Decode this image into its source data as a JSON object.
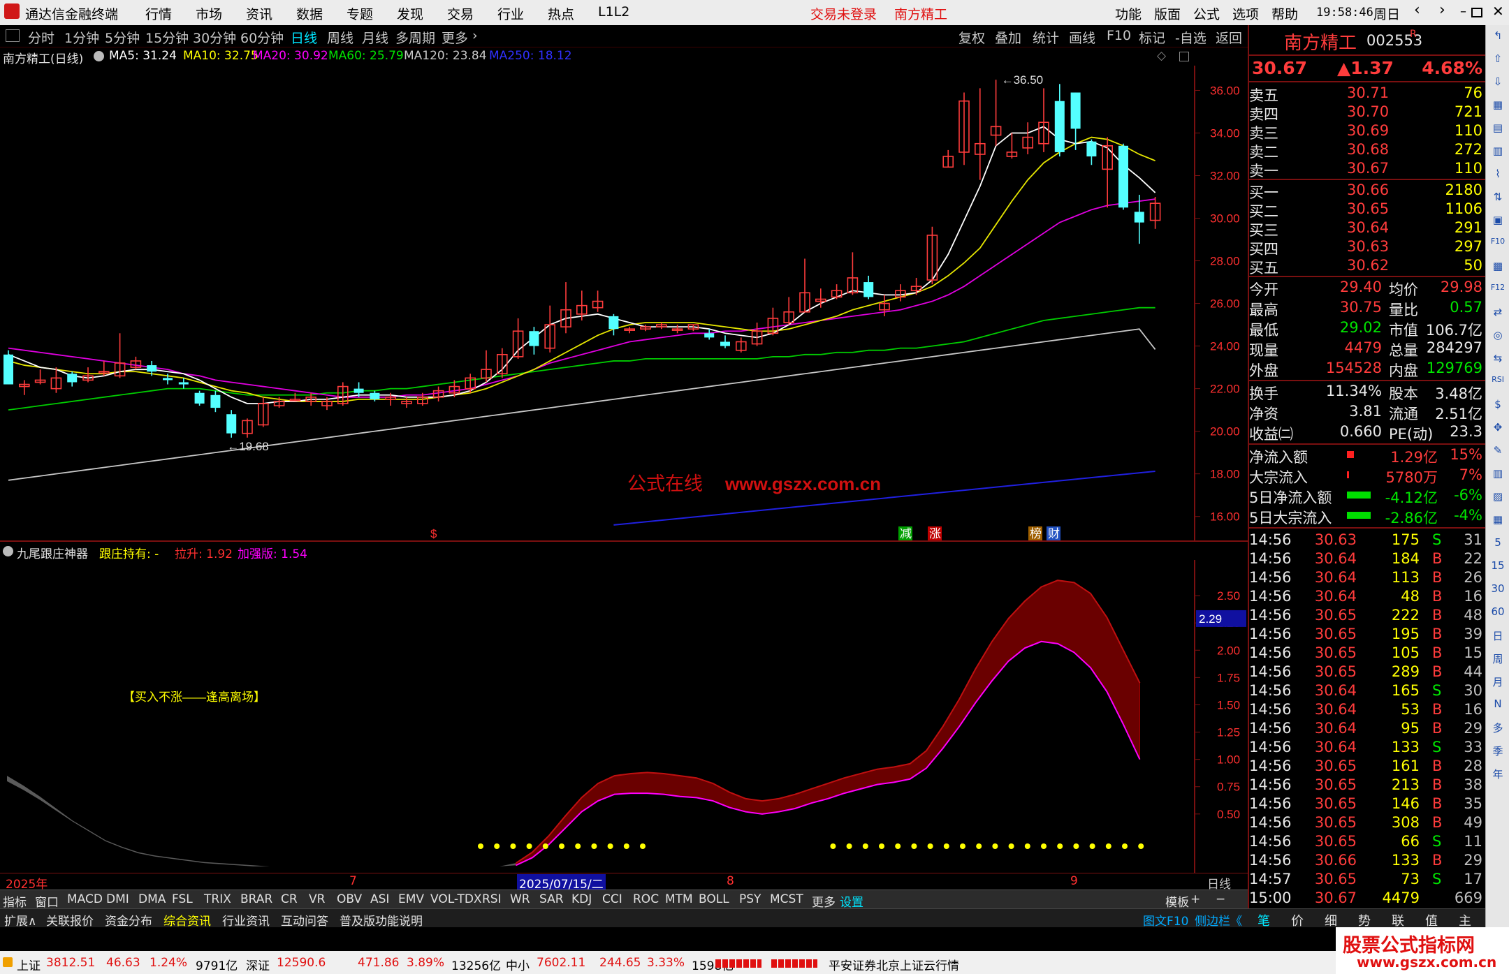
{
  "titlebar": {
    "app": "通达信金融终端",
    "menus": [
      "行情",
      "市场",
      "资讯",
      "数据",
      "专题",
      "发现",
      "交易",
      "行业",
      "热点",
      "L1L2"
    ],
    "login": "交易未登录",
    "stock": "南方精工",
    "right": [
      "功能",
      "版面",
      "公式",
      "选项",
      "帮助"
    ],
    "time": "19:58:46",
    "day": "周日"
  },
  "periods": [
    "分时",
    "1分钟",
    "5分钟",
    "15分钟",
    "30分钟",
    "60分钟",
    "日线",
    "周线",
    "月线",
    "多周期",
    "更多"
  ],
  "active_period": "日线",
  "tools": [
    "复权",
    "叠加",
    "统计",
    "画线",
    "F10",
    "标记",
    "-自选",
    "返回"
  ],
  "chart_info": {
    "name": "南方精工(日线)",
    "ma": [
      {
        "label": "MA5: 31.24",
        "color": "#ffffff"
      },
      {
        "label": "MA10: 32.75",
        "color": "#ffff00"
      },
      {
        "label": "MA20: 30.92",
        "color": "#ff00ff"
      },
      {
        "label": "MA60: 25.79",
        "color": "#00e600"
      },
      {
        "label": "MA120: 23.84",
        "color": "#c8c8c8"
      },
      {
        "label": "MA250: 18.12",
        "color": "#3030ff"
      }
    ]
  },
  "chart_data": {
    "type": "candlestick",
    "yticks": [
      16.0,
      18.0,
      20.0,
      22.0,
      24.0,
      26.0,
      28.0,
      30.0,
      32.0,
      34.0,
      36.0
    ],
    "ylim": [
      15.4,
      36.9
    ],
    "high_label": "36.50",
    "low_label": "19.68",
    "candles": [
      [
        23.6,
        22.2,
        23.8,
        22.2
      ],
      [
        22.1,
        22.2,
        22.4,
        21.7
      ],
      [
        22.3,
        22.4,
        22.9,
        22.2
      ],
      [
        22.0,
        22.5,
        23.0,
        21.8
      ],
      [
        22.7,
        22.3,
        22.8,
        22.1
      ],
      [
        22.4,
        22.6,
        23.0,
        22.3
      ],
      [
        22.8,
        22.8,
        23.3,
        22.6
      ],
      [
        22.6,
        23.2,
        24.6,
        22.5
      ],
      [
        23.0,
        23.3,
        23.5,
        22.9
      ],
      [
        23.1,
        22.8,
        23.3,
        22.6
      ],
      [
        22.5,
        22.4,
        22.7,
        22.2
      ],
      [
        22.3,
        22.2,
        22.5,
        22.0
      ],
      [
        21.8,
        21.3,
        21.9,
        21.2
      ],
      [
        21.7,
        21.1,
        21.9,
        20.9
      ],
      [
        20.8,
        19.9,
        21.0,
        19.7
      ],
      [
        19.9,
        20.5,
        20.6,
        19.7
      ],
      [
        20.3,
        21.3,
        21.6,
        20.2
      ],
      [
        21.2,
        21.4,
        21.6,
        21.1
      ],
      [
        21.5,
        21.5,
        21.8,
        21.4
      ],
      [
        21.4,
        21.6,
        21.8,
        21.2
      ],
      [
        21.2,
        21.4,
        21.6,
        21.0
      ],
      [
        21.3,
        22.1,
        22.3,
        21.2
      ],
      [
        22.0,
        21.8,
        22.3,
        21.6
      ],
      [
        21.8,
        21.5,
        21.9,
        21.4
      ],
      [
        21.5,
        21.6,
        21.8,
        21.2
      ],
      [
        21.3,
        21.4,
        21.6,
        21.1
      ],
      [
        21.3,
        21.6,
        21.8,
        21.2
      ],
      [
        21.6,
        21.9,
        22.1,
        21.4
      ],
      [
        21.8,
        22.1,
        22.4,
        21.6
      ],
      [
        22.0,
        22.5,
        22.7,
        21.8
      ],
      [
        22.5,
        22.9,
        23.8,
        22.3
      ],
      [
        22.7,
        23.6,
        23.9,
        22.5
      ],
      [
        23.5,
        24.7,
        25.3,
        23.4
      ],
      [
        24.7,
        24.0,
        24.9,
        23.6
      ],
      [
        23.9,
        25.0,
        25.9,
        23.7
      ],
      [
        24.9,
        25.7,
        27.0,
        24.6
      ],
      [
        25.5,
        25.9,
        26.6,
        25.2
      ],
      [
        25.8,
        26.1,
        26.6,
        25.6
      ],
      [
        25.4,
        24.8,
        25.5,
        24.5
      ],
      [
        24.8,
        24.8,
        24.9,
        24.6
      ],
      [
        24.8,
        24.9,
        25.0,
        24.7
      ],
      [
        24.9,
        25.0,
        25.1,
        24.8
      ],
      [
        24.8,
        24.8,
        25.0,
        24.6
      ],
      [
        24.8,
        25.0,
        25.0,
        24.7
      ],
      [
        24.6,
        24.4,
        24.8,
        24.3
      ],
      [
        24.2,
        24.0,
        24.5,
        23.9
      ],
      [
        23.8,
        24.2,
        24.4,
        23.7
      ],
      [
        24.1,
        24.7,
        25.1,
        24.0
      ],
      [
        24.6,
        25.3,
        25.8,
        24.5
      ],
      [
        25.1,
        25.6,
        26.3,
        25.0
      ],
      [
        25.6,
        26.5,
        28.1,
        25.6
      ],
      [
        26.1,
        26.2,
        26.7,
        25.8
      ],
      [
        26.3,
        26.6,
        26.9,
        26.2
      ],
      [
        26.5,
        27.2,
        28.4,
        26.4
      ],
      [
        27.0,
        26.3,
        27.3,
        26.2
      ],
      [
        25.7,
        26.0,
        26.4,
        25.4
      ],
      [
        26.3,
        26.6,
        26.9,
        26.1
      ],
      [
        26.6,
        26.8,
        27.2,
        26.4
      ],
      [
        27.1,
        29.2,
        29.6,
        26.9
      ],
      [
        32.4,
        32.9,
        33.2,
        32.4
      ],
      [
        33.1,
        35.5,
        35.9,
        32.5
      ],
      [
        33.0,
        33.5,
        36.1,
        31.8
      ],
      [
        33.9,
        34.3,
        36.5,
        33.4
      ],
      [
        32.9,
        33.1,
        34.0,
        32.8
      ],
      [
        33.3,
        33.8,
        34.5,
        33.0
      ],
      [
        33.5,
        34.5,
        36.1,
        33.1
      ],
      [
        35.5,
        33.1,
        36.3,
        32.9
      ],
      [
        35.9,
        34.2,
        35.9,
        33.2
      ],
      [
        33.6,
        32.9,
        33.7,
        32.5
      ],
      [
        32.3,
        33.4,
        33.8,
        30.5
      ],
      [
        33.4,
        30.5,
        33.5,
        30.4
      ],
      [
        30.3,
        29.8,
        31.1,
        28.8
      ],
      [
        29.9,
        30.7,
        31.0,
        29.5
      ]
    ],
    "ma_series": {
      "MA5": [
        23.6,
        23.3,
        23.0,
        22.9,
        22.6,
        22.5,
        22.6,
        22.8,
        22.9,
        22.9,
        22.8,
        22.7,
        22.4,
        22.0,
        21.6,
        21.3,
        21.3,
        21.4,
        21.4,
        21.5,
        21.5,
        21.6,
        21.7,
        21.7,
        21.7,
        21.6,
        21.6,
        21.6,
        21.7,
        21.9,
        22.3,
        22.9,
        23.8,
        24.4,
        25.0,
        25.3,
        25.4,
        25.5,
        25.3,
        25.1,
        24.9,
        24.9,
        24.9,
        24.9,
        24.8,
        24.6,
        24.5,
        24.4,
        24.6,
        25.0,
        25.6,
        26.0,
        26.3,
        26.6,
        26.5,
        26.4,
        26.4,
        26.5,
        27.1,
        28.3,
        29.9,
        31.5,
        33.4,
        34.0,
        34.0,
        34.3,
        33.7,
        33.5,
        33.6,
        33.3,
        32.5,
        31.9,
        31.2
      ],
      "MA10": [
        23.3,
        23.1,
        23.0,
        22.9,
        22.8,
        22.7,
        22.7,
        22.8,
        22.8,
        22.7,
        22.6,
        22.5,
        22.3,
        22.1,
        21.9,
        21.8,
        21.6,
        21.5,
        21.4,
        21.4,
        21.4,
        21.4,
        21.5,
        21.5,
        21.5,
        21.5,
        21.5,
        21.6,
        21.7,
        21.8,
        22.0,
        22.3,
        22.6,
        22.9,
        23.3,
        23.7,
        24.1,
        24.5,
        24.8,
        25.0,
        25.1,
        25.1,
        25.1,
        25.1,
        25.0,
        24.9,
        24.8,
        24.7,
        24.7,
        24.8,
        25.0,
        25.2,
        25.4,
        25.7,
        25.9,
        26.1,
        26.3,
        26.5,
        26.8,
        27.3,
        27.9,
        28.6,
        29.7,
        30.8,
        31.8,
        32.6,
        33.1,
        33.5,
        33.8,
        33.7,
        33.4,
        33.0,
        32.7
      ],
      "MA20": [
        23.9,
        23.8,
        23.7,
        23.6,
        23.5,
        23.4,
        23.3,
        23.2,
        23.1,
        23.0,
        22.9,
        22.7,
        22.6,
        22.4,
        22.3,
        22.2,
        22.1,
        22.0,
        21.9,
        21.8,
        21.7,
        21.6,
        21.6,
        21.6,
        21.6,
        21.7,
        21.7,
        21.8,
        21.9,
        22.0,
        22.2,
        22.4,
        22.6,
        22.9,
        23.2,
        23.4,
        23.6,
        23.8,
        24.0,
        24.2,
        24.3,
        24.4,
        24.5,
        24.6,
        24.6,
        24.7,
        24.7,
        24.8,
        24.9,
        25.0,
        25.1,
        25.2,
        25.3,
        25.4,
        25.5,
        25.6,
        25.7,
        25.9,
        26.1,
        26.4,
        26.8,
        27.3,
        27.8,
        28.3,
        28.8,
        29.3,
        29.8,
        30.1,
        30.4,
        30.6,
        30.7,
        30.8,
        30.9
      ],
      "MA60": [
        21.0,
        21.1,
        21.2,
        21.3,
        21.4,
        21.5,
        21.6,
        21.7,
        21.8,
        21.9,
        22.0,
        22.0,
        22.0,
        21.9,
        21.8,
        21.7,
        21.7,
        21.7,
        21.7,
        21.7,
        21.8,
        21.8,
        21.9,
        21.9,
        22.0,
        22.0,
        22.1,
        22.2,
        22.3,
        22.4,
        22.5,
        22.6,
        22.7,
        22.8,
        22.9,
        23.0,
        23.1,
        23.2,
        23.3,
        23.3,
        23.4,
        23.4,
        23.4,
        23.4,
        23.4,
        23.4,
        23.4,
        23.4,
        23.5,
        23.5,
        23.6,
        23.6,
        23.7,
        23.7,
        23.8,
        23.8,
        23.9,
        23.9,
        24.0,
        24.1,
        24.2,
        24.4,
        24.6,
        24.8,
        25.0,
        25.2,
        25.3,
        25.4,
        25.5,
        25.6,
        25.7,
        25.8,
        25.8
      ],
      "MA120": [
        17.7,
        17.8,
        17.9,
        18.0,
        18.1,
        18.2,
        18.3,
        18.4,
        18.5,
        18.6,
        18.7,
        18.8,
        18.9,
        19.0,
        19.1,
        19.2,
        19.3,
        19.4,
        19.5,
        19.6,
        19.7,
        19.8,
        19.9,
        20.0,
        20.1,
        20.2,
        20.3,
        20.4,
        20.5,
        20.6,
        20.7,
        20.8,
        20.9,
        21.0,
        21.1,
        21.2,
        21.3,
        21.4,
        21.5,
        21.6,
        21.7,
        21.8,
        21.9,
        22.0,
        22.1,
        22.2,
        22.3,
        22.4,
        22.5,
        22.6,
        22.7,
        22.8,
        22.9,
        23.0,
        23.1,
        23.2,
        23.3,
        23.4,
        23.5,
        23.6,
        23.7,
        23.8,
        23.9,
        24.0,
        24.1,
        24.2,
        24.3,
        24.4,
        24.5,
        24.6,
        24.7,
        24.8,
        23.84
      ]
    },
    "ma250_points": [
      [
        38,
        15.6
      ],
      [
        72,
        18.12
      ]
    ]
  },
  "markers": [
    {
      "text": "$",
      "color": "#ff3030",
      "bg": ""
    },
    {
      "text": "减",
      "color": "#ffffff",
      "bg": "#00a000"
    },
    {
      "text": "涨",
      "color": "#ffffff",
      "bg": "#c00000"
    },
    {
      "text": "榜",
      "color": "#ffffff",
      "bg": "#a06000"
    },
    {
      "text": "财",
      "color": "#ffffff",
      "bg": "#2050c0"
    }
  ],
  "watermark": {
    "cn": "公式在线",
    "url": "www.gszx.com.cn"
  },
  "sub_indicator": {
    "name": "九尾跟庄神器",
    "hold_label": "跟庄持有: -",
    "pull_label": "拉升: 1.92",
    "strong_label": "加强版: 1.54",
    "note": "【买入不涨——逢高离场】",
    "cursor_value": "2.29",
    "yticks": [
      "2.50",
      "2.25",
      "2.00",
      "1.75",
      "1.50",
      "1.25",
      "1.00",
      "0.75",
      "0.50"
    ],
    "ylim": [
      0,
      2.75
    ],
    "upper": [
      0.85,
      0.76,
      0.66,
      0.55,
      0.44,
      0.35,
      0.26,
      0.2,
      0.15,
      0.12,
      0.1,
      0.08,
      0.06,
      0.05,
      0.04,
      0.03,
      0.02,
      0.02,
      0.02,
      0.02,
      0.02,
      0.02,
      0.02,
      0.02,
      0.02,
      0.02,
      0.02,
      0.02,
      0.02,
      0.02,
      0.02,
      0.05,
      0.15,
      0.3,
      0.48,
      0.65,
      0.78,
      0.85,
      0.87,
      0.88,
      0.87,
      0.85,
      0.83,
      0.78,
      0.7,
      0.64,
      0.62,
      0.64,
      0.68,
      0.73,
      0.78,
      0.83,
      0.87,
      0.91,
      0.93,
      0.96,
      1.08,
      1.3,
      1.55,
      1.83,
      2.08,
      2.29,
      2.45,
      2.58,
      2.64,
      2.62,
      2.52,
      2.3,
      2.0,
      1.7
    ],
    "lower": [
      0.8,
      0.72,
      0.63,
      0.53,
      0.43,
      0.34,
      0.25,
      0.19,
      0.14,
      0.11,
      0.09,
      0.07,
      0.05,
      0.04,
      0.03,
      0.02,
      0.02,
      0.02,
      0.02,
      0.02,
      0.02,
      0.02,
      0.02,
      0.02,
      0.02,
      0.02,
      0.02,
      0.02,
      0.02,
      0.02,
      0.02,
      0.03,
      0.1,
      0.22,
      0.37,
      0.52,
      0.62,
      0.68,
      0.69,
      0.69,
      0.68,
      0.66,
      0.65,
      0.62,
      0.56,
      0.52,
      0.5,
      0.52,
      0.55,
      0.6,
      0.64,
      0.69,
      0.73,
      0.77,
      0.79,
      0.82,
      0.92,
      1.1,
      1.3,
      1.52,
      1.72,
      1.9,
      2.02,
      2.08,
      2.06,
      1.98,
      1.84,
      1.62,
      1.32,
      1.0
    ],
    "dots_ranges": [
      [
        30,
        40
      ],
      [
        47,
        66
      ]
    ]
  },
  "date_axis": {
    "year": "2025年",
    "m7": "7",
    "cursor": "2025/07/15/二",
    "m8": "8",
    "m9": "9",
    "period": "日线"
  },
  "indicators": [
    "指标",
    "窗口",
    "MACD",
    "DMI",
    "DMA",
    "FSL",
    "TRIX",
    "BRAR",
    "CR",
    "VR",
    "OBV",
    "ASI",
    "EMV",
    "VOL-TDX",
    "RSI",
    "WR",
    "SAR",
    "KDJ",
    "CCI",
    "ROC",
    "MTM",
    "BOLL",
    "PSY",
    "MCST",
    "更多",
    "设置",
    "模板",
    "+",
    "−"
  ],
  "toolbar2": [
    "扩展∧",
    "关联报价",
    "资金分布",
    "综合资讯",
    "行业资讯",
    "互动问答",
    "普及版功能说明",
    "图文F10",
    "侧边栏《"
  ],
  "rtabs": [
    "笔",
    "价",
    "细",
    "势",
    "联",
    "值",
    "主"
  ],
  "quote": {
    "name": "南方精工",
    "code": "002553",
    "flag": "R",
    "price": "30.67",
    "change": "▲1.37",
    "pct": "4.68%",
    "asks": [
      [
        "卖五",
        "30.71",
        "76"
      ],
      [
        "卖四",
        "30.70",
        "721"
      ],
      [
        "卖三",
        "30.69",
        "110"
      ],
      [
        "卖二",
        "30.68",
        "272"
      ],
      [
        "卖一",
        "30.67",
        "110"
      ]
    ],
    "bids": [
      [
        "买一",
        "30.66",
        "2180"
      ],
      [
        "买二",
        "30.65",
        "1106"
      ],
      [
        "买三",
        "30.64",
        "291"
      ],
      [
        "买四",
        "30.63",
        "297"
      ],
      [
        "买五",
        "30.62",
        "50"
      ]
    ],
    "stats1": [
      [
        "今开",
        "29.40",
        "均价",
        "29.98"
      ],
      [
        "最高",
        "30.75",
        "量比",
        "0.57"
      ],
      [
        "最低",
        "29.02",
        "市值",
        "106.7亿"
      ],
      [
        "现量",
        "4479",
        "总量",
        "284297"
      ],
      [
        "外盘",
        "154528",
        "内盘",
        "129769"
      ]
    ],
    "stats2": [
      [
        "换手",
        "11.34%",
        "股本",
        "3.48亿"
      ],
      [
        "净资",
        "3.81",
        "流通",
        "2.51亿"
      ],
      [
        "收益㈡",
        "0.660",
        "PE(动)",
        "23.3"
      ]
    ],
    "flows": [
      [
        "净流入额",
        "1.29亿",
        "15%"
      ],
      [
        "大宗流入",
        "5780万",
        "7%"
      ],
      [
        "5日净流入额",
        "-4.12亿",
        "-6%"
      ],
      [
        "5日大宗流入",
        "-2.86亿",
        "-4%"
      ]
    ],
    "ticks": [
      [
        "14:56",
        "30.63",
        "175",
        "S",
        "31"
      ],
      [
        "14:56",
        "30.64",
        "184",
        "B",
        "22"
      ],
      [
        "14:56",
        "30.64",
        "113",
        "B",
        "26"
      ],
      [
        "14:56",
        "30.64",
        "48",
        "B",
        "16"
      ],
      [
        "14:56",
        "30.65",
        "222",
        "B",
        "48"
      ],
      [
        "14:56",
        "30.65",
        "195",
        "B",
        "39"
      ],
      [
        "14:56",
        "30.65",
        "105",
        "B",
        "15"
      ],
      [
        "14:56",
        "30.65",
        "289",
        "B",
        "44"
      ],
      [
        "14:56",
        "30.64",
        "165",
        "S",
        "30"
      ],
      [
        "14:56",
        "30.64",
        "53",
        "B",
        "16"
      ],
      [
        "14:56",
        "30.64",
        "95",
        "B",
        "29"
      ],
      [
        "14:56",
        "30.64",
        "133",
        "S",
        "33"
      ],
      [
        "14:56",
        "30.65",
        "161",
        "B",
        "28"
      ],
      [
        "14:56",
        "30.65",
        "213",
        "B",
        "38"
      ],
      [
        "14:56",
        "30.65",
        "146",
        "B",
        "35"
      ],
      [
        "14:56",
        "30.65",
        "308",
        "B",
        "49"
      ],
      [
        "14:56",
        "30.65",
        "66",
        "S",
        "11"
      ],
      [
        "14:56",
        "30.66",
        "133",
        "B",
        "29"
      ],
      [
        "14:57",
        "30.65",
        "73",
        "S",
        "17"
      ],
      [
        "15:00",
        "30.67",
        "4479",
        "",
        "669"
      ]
    ]
  },
  "sidebar_icons": [
    "↰",
    "⇧",
    "⇩",
    "▦",
    "▤",
    "▥",
    "⌇",
    "⇅",
    "▣",
    "F10",
    "▩",
    "F12",
    "⇄",
    "◎",
    "⇆",
    "RSI",
    "$",
    "✥",
    "✎",
    "▥",
    "▨",
    "▦",
    "5",
    "15",
    "30",
    "60",
    "日",
    "周",
    "月",
    "N",
    "多",
    "季",
    "年"
  ],
  "status": {
    "sh_label": "上证",
    "sh": "3812.51",
    "sh_chg": "46.63",
    "sh_pct": "1.24%",
    "sh_amt": "9791亿",
    "sz_label": "深证",
    "sz": "12590.6",
    "sz_chg": "471.86",
    "sz_pct": "3.89%",
    "sz_amt": "13256亿",
    "zx_label": "中小",
    "zx": "7602.11",
    "zx_chg": "244.65",
    "zx_pct": "3.33%",
    "zx_amt": "1598亿",
    "broker": "平安证券北京上证云行情"
  },
  "logo": {
    "top": "股票公式指标网",
    "bottom": "www.gszx.com.cn"
  }
}
